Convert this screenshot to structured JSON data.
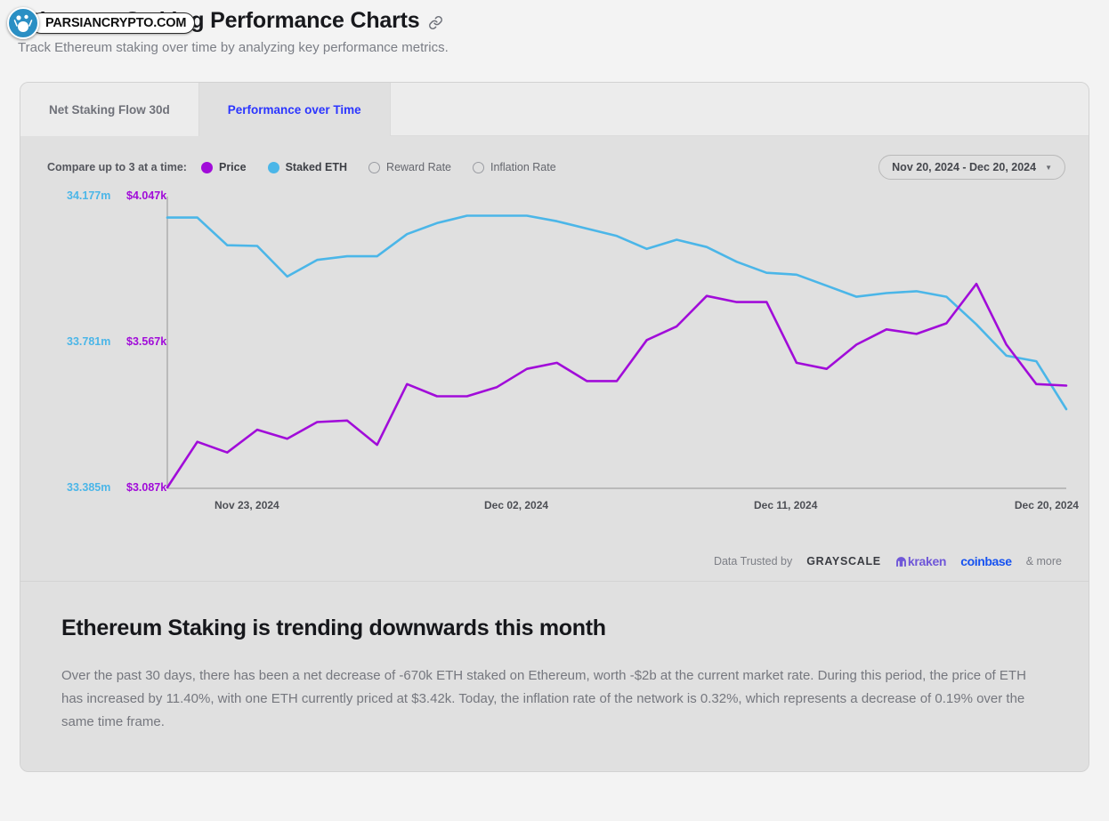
{
  "watermark": {
    "text": "PARSIANCRYPTO.COM",
    "logo_icon": "parsiancrypto-logo-icon"
  },
  "header": {
    "title": "Ethereum Staking Performance Charts",
    "subtitle": "Track Ethereum staking over time by analyzing key performance metrics.",
    "link_icon": "anchor-link-icon"
  },
  "tabs": [
    {
      "label": "Net Staking Flow 30d",
      "active": false
    },
    {
      "label": "Performance over Time",
      "active": true
    }
  ],
  "controls": {
    "compare_label": "Compare up to 3 at a time:",
    "series_options": [
      {
        "label": "Price",
        "selected": true,
        "color": "#a10cd9"
      },
      {
        "label": "Staked ETH",
        "selected": true,
        "color": "#4bb6e8"
      },
      {
        "label": "Reward Rate",
        "selected": false,
        "color": "#9a9ca2"
      },
      {
        "label": "Inflation Rate",
        "selected": false,
        "color": "#9a9ca2"
      }
    ],
    "date_range": "Nov 20, 2024 - Dec 20, 2024",
    "date_caret_icon": "chevron-down-icon"
  },
  "trusted": {
    "lead": "Data Trusted by",
    "logos": [
      "GRAYSCALE",
      "kraken",
      "coinbase"
    ],
    "more": "& more"
  },
  "summary": {
    "title": "Ethereum Staking is trending downwards this month",
    "body": "Over the past 30 days, there has been a net decrease of -670k ETH staked on Ethereum, worth -$2b at the current market rate. During this period, the price of ETH has increased by 11.40%, with one ETH currently priced at $3.42k. Today, the inflation rate of the network is 0.32%, which represents a decrease of 0.19% over the same time frame."
  },
  "chart_data": {
    "type": "line",
    "title": "Performance over Time",
    "xlabel": "",
    "grid": false,
    "legend_position": "top-left",
    "x_tick_labels": [
      "Nov 23, 2024",
      "Dec 02, 2024",
      "Dec 11, 2024",
      "Dec 20, 2024"
    ],
    "x_tick_positions": [
      0.1,
      0.4,
      0.7,
      0.99
    ],
    "axes": [
      {
        "name": "Staked ETH",
        "side": "left-outer",
        "color": "#4bb6e8",
        "tick_labels": [
          "34.177m",
          "33.781m",
          "33.385m"
        ],
        "tick_values": [
          34.177,
          33.781,
          33.385
        ],
        "unit": "m ETH",
        "ylim": [
          33.385,
          34.177
        ]
      },
      {
        "name": "Price",
        "side": "left-inner",
        "color": "#a10cd9",
        "tick_labels": [
          "$4.047k",
          "$3.567k",
          "$3.087k"
        ],
        "tick_values": [
          4.047,
          3.567,
          3.087
        ],
        "unit": "$k",
        "ylim": [
          3.087,
          4.047
        ]
      }
    ],
    "series": [
      {
        "name": "Staked ETH",
        "color": "#4bb6e8",
        "axis": "Staked ETH",
        "unit": "m ETH",
        "values": [
          34.12,
          34.12,
          34.045,
          34.043,
          33.96,
          34.005,
          34.015,
          34.015,
          34.075,
          34.105,
          34.125,
          34.125,
          34.125,
          34.11,
          34.09,
          34.07,
          34.035,
          34.06,
          34.04,
          34.0,
          33.97,
          33.965,
          33.935,
          33.905,
          33.915,
          33.92,
          33.905,
          33.83,
          33.745,
          33.73,
          33.6
        ]
      },
      {
        "name": "Price",
        "color": "#a10cd9",
        "axis": "Price",
        "unit": "$k",
        "values": [
          3.09,
          3.24,
          3.205,
          3.28,
          3.25,
          3.305,
          3.31,
          3.23,
          3.43,
          3.39,
          3.39,
          3.42,
          3.48,
          3.5,
          3.44,
          3.44,
          3.575,
          3.62,
          3.72,
          3.7,
          3.7,
          3.5,
          3.48,
          3.56,
          3.61,
          3.595,
          3.63,
          3.76,
          3.56,
          3.43,
          3.425
        ]
      }
    ],
    "annotations": []
  }
}
